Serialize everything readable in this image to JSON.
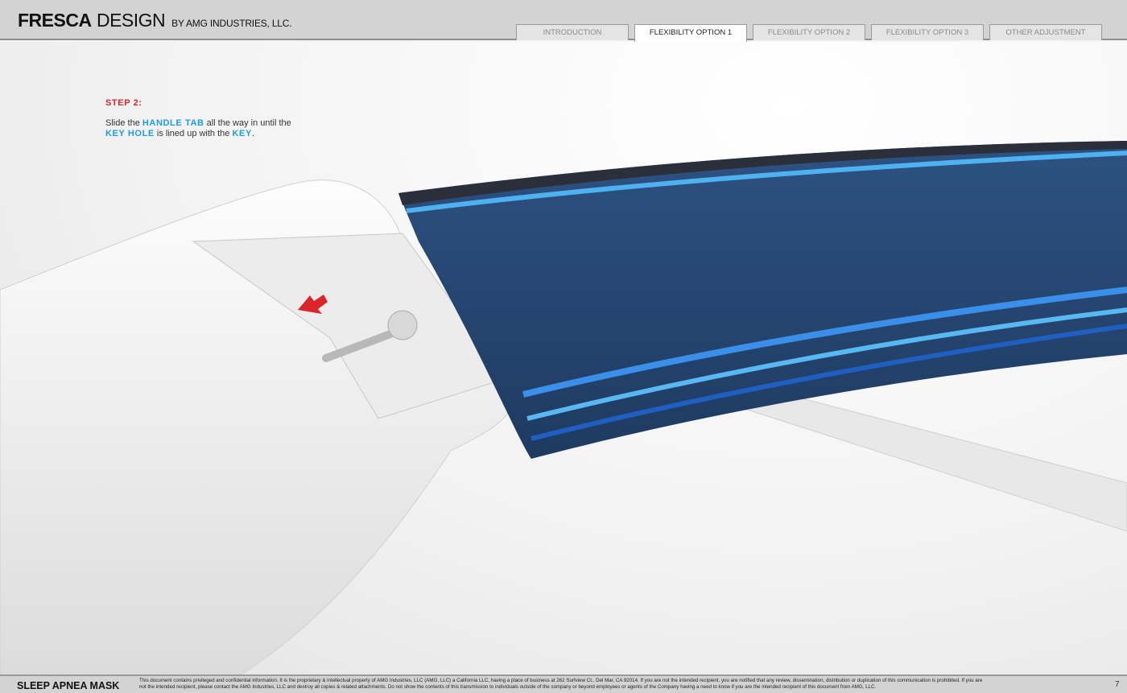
{
  "header": {
    "brand_bold": "FRESCA",
    "brand_light": "DESIGN",
    "brand_by": "BY AMG INDUSTRIES, LLC."
  },
  "tabs": [
    {
      "label": "INTRODUCTION",
      "active": false
    },
    {
      "label": "FLEXIBILITY OPTION 1",
      "active": true
    },
    {
      "label": "FLEXIBILITY OPTION 2",
      "active": false
    },
    {
      "label": "FLEXIBILITY OPTION 3",
      "active": false
    },
    {
      "label": "OTHER ADJUSTMENT",
      "active": false
    }
  ],
  "step": {
    "label": "STEP 2:",
    "t1": "Slide the ",
    "k1": "HANDLE TAB",
    "t2": " all the way in until the",
    "k2": "KEY HOLE",
    "t3": " is lined up with the ",
    "k3": "KEY",
    "t4": "."
  },
  "colors": {
    "accent_red": "#d9262b",
    "accent_blue": "#1e9be0",
    "band_blue": "#24446e"
  },
  "footer": {
    "title": "SLEEP APNEA MASK",
    "legal": "This document contains privileged and confidential information. It is the proprietary & intellectual property of AMG Industries, LLC (AMG, LLC) a California LLC, having a place of business at 262 Surfview Ct., Del Mar, CA 92014. If you are not the intended recipient, you are notified that any review, dissemination, distribution or duplication of this communication is prohibited. If you are not the intended recipient, please contact the AMG Industries, LLC and destroy all copies & related attachments. Do not show the contents of this transmission to individuals outside of the company or beyond employees or agents of the Company having a need to know if you are the intended recipient of this document from AMG, LLC.",
    "page": "7"
  }
}
